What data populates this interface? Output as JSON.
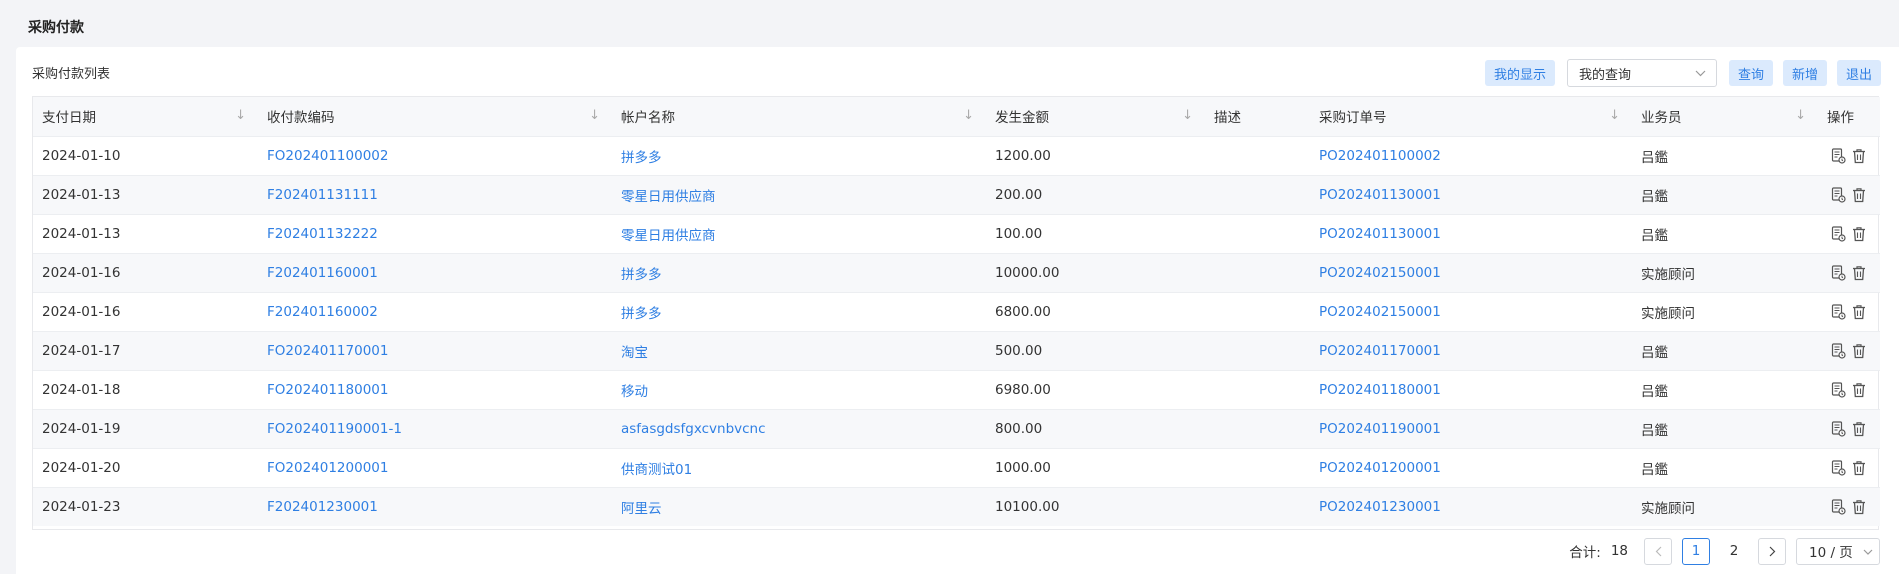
{
  "page": {
    "title": "采购付款"
  },
  "list": {
    "title": "采购付款列表"
  },
  "toolbar": {
    "my_display": "我的显示",
    "query_select": "我的查询",
    "query": "查询",
    "add": "新增",
    "exit": "退出"
  },
  "table": {
    "headers": {
      "pay_date": "支付日期",
      "code": "收付款编码",
      "account": "帐户名称",
      "amount": "发生金额",
      "desc": "描述",
      "po": "采购订单号",
      "staff": "业务员",
      "ops": "操作"
    },
    "rows": [
      {
        "date": "2024-01-10",
        "code": "FO202401100002",
        "account": "拼多多",
        "amount": "1200.00",
        "desc": "",
        "po": "PO202401100002",
        "staff": "吕鑑"
      },
      {
        "date": "2024-01-13",
        "code": "F202401131111",
        "account": "零星日用供应商",
        "amount": "200.00",
        "desc": "",
        "po": "PO202401130001",
        "staff": "吕鑑"
      },
      {
        "date": "2024-01-13",
        "code": "F202401132222",
        "account": "零星日用供应商",
        "amount": "100.00",
        "desc": "",
        "po": "PO202401130001",
        "staff": "吕鑑"
      },
      {
        "date": "2024-01-16",
        "code": "F202401160001",
        "account": "拼多多",
        "amount": "10000.00",
        "desc": "",
        "po": "PO202402150001",
        "staff": "实施顾问"
      },
      {
        "date": "2024-01-16",
        "code": "F202401160002",
        "account": "拼多多",
        "amount": "6800.00",
        "desc": "",
        "po": "PO202402150001",
        "staff": "实施顾问"
      },
      {
        "date": "2024-01-17",
        "code": "FO202401170001",
        "account": "淘宝",
        "amount": "500.00",
        "desc": "",
        "po": "PO202401170001",
        "staff": "吕鑑"
      },
      {
        "date": "2024-01-18",
        "code": "FO202401180001",
        "account": "移动",
        "amount": "6980.00",
        "desc": "",
        "po": "PO202401180001",
        "staff": "吕鑑"
      },
      {
        "date": "2024-01-19",
        "code": "FO202401190001-1",
        "account": "asfasgdsfgxcvnbvcnc",
        "amount": "800.00",
        "desc": "",
        "po": "PO202401190001",
        "staff": "吕鑑"
      },
      {
        "date": "2024-01-20",
        "code": "FO202401200001",
        "account": "供商测试01",
        "amount": "1000.00",
        "desc": "",
        "po": "PO202401200001",
        "staff": "吕鑑"
      },
      {
        "date": "2024-01-23",
        "code": "F202401230001",
        "account": "阿里云",
        "amount": "10100.00",
        "desc": "",
        "po": "PO202401230001",
        "staff": "实施顾问"
      }
    ]
  },
  "pagination": {
    "total_label": "合计:",
    "total": "18",
    "pages": [
      "1",
      "2"
    ],
    "current": "1",
    "page_size": "10 / 页"
  },
  "colors": {
    "accent": "#2f7fe3",
    "button_bg": "#dbeafd"
  },
  "icons": {
    "sort": "arrow-down-icon",
    "detail": "document-detail-icon",
    "delete": "trash-icon"
  }
}
